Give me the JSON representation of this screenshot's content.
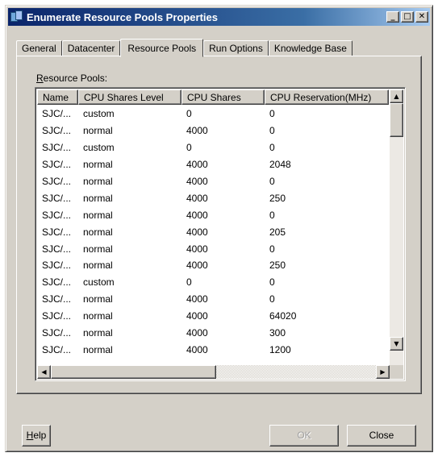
{
  "window": {
    "title": "Enumerate Resource Pools Properties"
  },
  "titlebar_buttons": {
    "minimize": "_",
    "maximize": "□",
    "close": "✕"
  },
  "tabs": [
    {
      "label": "General"
    },
    {
      "label": "Datacenter"
    },
    {
      "label": "Resource Pools"
    },
    {
      "label": "Run Options"
    },
    {
      "label": "Knowledge Base"
    }
  ],
  "active_tab": "Resource Pools",
  "list": {
    "label_prefix": "R",
    "label_rest": "esource Pools:",
    "columns": [
      "Name",
      "CPU Shares Level",
      "CPU Shares",
      "CPU Reservation(MHz)"
    ],
    "rows": [
      [
        "SJC/...",
        "custom",
        "0",
        "0"
      ],
      [
        "SJC/...",
        "normal",
        "4000",
        "0"
      ],
      [
        "SJC/...",
        "custom",
        "0",
        "0"
      ],
      [
        "SJC/...",
        "normal",
        "4000",
        "2048"
      ],
      [
        "SJC/...",
        "normal",
        "4000",
        "0"
      ],
      [
        "SJC/...",
        "normal",
        "4000",
        "250"
      ],
      [
        "SJC/...",
        "normal",
        "4000",
        "0"
      ],
      [
        "SJC/...",
        "normal",
        "4000",
        "205"
      ],
      [
        "SJC/...",
        "normal",
        "4000",
        "0"
      ],
      [
        "SJC/...",
        "normal",
        "4000",
        "250"
      ],
      [
        "SJC/...",
        "custom",
        "0",
        "0"
      ],
      [
        "SJC/...",
        "normal",
        "4000",
        "0"
      ],
      [
        "SJC/...",
        "normal",
        "4000",
        "64020"
      ],
      [
        "SJC/...",
        "normal",
        "4000",
        "300"
      ],
      [
        "SJC/...",
        "normal",
        "4000",
        "1200"
      ]
    ]
  },
  "scroll_arrows": {
    "up": "▲",
    "down": "▼",
    "left": "◀",
    "right": "▶"
  },
  "buttons": {
    "help_prefix": "H",
    "help_rest": "elp",
    "ok": "OK",
    "close": "Close"
  }
}
